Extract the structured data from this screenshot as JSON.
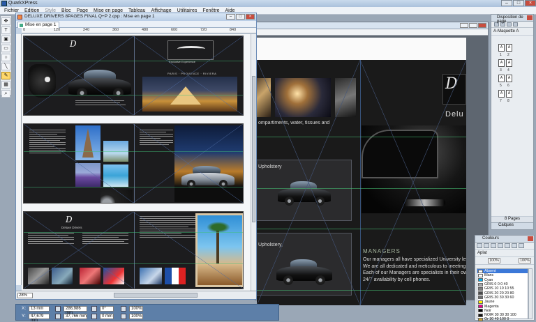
{
  "app": {
    "title": "QuarkXPress",
    "menu": [
      "Fichier",
      "Edition",
      "Style",
      "Bloc",
      "Page",
      "Mise en page",
      "Tableau",
      "Affichage",
      "Utilitaires",
      "Fenêtre",
      "Aide"
    ]
  },
  "document": {
    "title": "DELUXE DRIVERS 8PAGES FINAL Q+P 2.qxp : Mise en page 1",
    "tab": "Mise en page 1",
    "zoom": "28%",
    "ruler_marks": [
      "0",
      "120",
      "240",
      "360",
      "480",
      "600",
      "720",
      "840"
    ]
  },
  "background_window": {
    "menu_lines": [
      "ompartiments, water, tissues and",
      "Upholstery",
      "Upholstery,"
    ],
    "brand": "Delu",
    "section_heading": "MANAGERS",
    "paragraph": [
      "Our managers all have specialized University level degre",
      "We are all dedicated and meticulous to meeting your",
      "Each of our Managers are specialists in their own re",
      "24/7 availability by cell phones."
    ]
  },
  "foreground_pages": {
    "spread1_caption": "Exclusive Experience",
    "spread1_subcaption": "PARIS · PROVENCE · RIVIERA",
    "spread3_brand": "Deluxe Drivers"
  },
  "measurements": {
    "x_label": "X:",
    "x_value": "13 mm",
    "y_label": "Y:",
    "y_value": "47,679 mm",
    "w_value": "286,986 mm",
    "h_value": "37,766 mm",
    "angle_value": "0°",
    "offset_value": "0 mm",
    "opacity1": "100%",
    "opacity2": "100%"
  },
  "pages_palette": {
    "title": "Disposition de page",
    "master": "A-Maquette A",
    "page_labels": [
      "1",
      "2",
      "3",
      "4",
      "5",
      "6",
      "7",
      "8"
    ],
    "pages_count": "8 Pages",
    "calques_label": "Calques"
  },
  "colors_palette": {
    "title": "Couleurs",
    "fill_label": "Aplat",
    "pct1": "100%",
    "pct2": "100%",
    "swatches": [
      {
        "name": "Absent",
        "color": "#ffffff",
        "selected": true
      },
      {
        "name": "Blanc",
        "color": "#ffffff"
      },
      {
        "name": "Cyan",
        "color": "#00aeef"
      },
      {
        "name": "GRIS 0 0 0 40",
        "color": "#a7a9ac"
      },
      {
        "name": "GRIS 10 10 10 55",
        "color": "#7d7d7f"
      },
      {
        "name": "GRIS 20 20 20 80",
        "color": "#4a4a4c"
      },
      {
        "name": "GRIS 30 30 30 60",
        "color": "#6e6e70"
      },
      {
        "name": "Jaune",
        "color": "#fff200"
      },
      {
        "name": "Magenta",
        "color": "#ec008c"
      },
      {
        "name": "Noir",
        "color": "#000000"
      },
      {
        "name": "NOIR 30 30 30 100",
        "color": "#111111"
      },
      {
        "name": "Or 30 40 100 0",
        "color": "#c7a53a"
      }
    ]
  }
}
